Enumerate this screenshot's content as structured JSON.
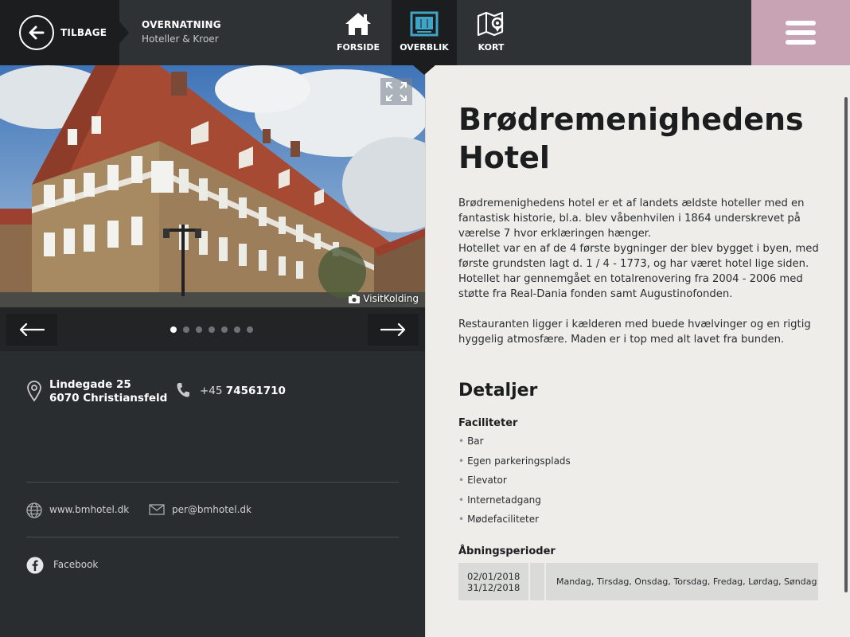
{
  "header": {
    "back_label": "TILBAGE",
    "category_title": "OVERNATNING",
    "category_sub": "Hoteller & Kroer",
    "nav": [
      {
        "label": "FORSIDE",
        "icon": "house-icon"
      },
      {
        "label": "OVERBLIK",
        "icon": "overview-icon",
        "active": true
      },
      {
        "label": "KORT",
        "icon": "map-icon"
      }
    ],
    "menu_icon": "hamburger-menu-icon",
    "menu_color": "#c8a3b3"
  },
  "gallery": {
    "photo_credit": "VisitKolding",
    "slide_count": 7,
    "active_slide": 1
  },
  "contact": {
    "address_line1": "Lindegade 25",
    "address_line2": "6070 Christiansfeld",
    "phone_prefix": "+45",
    "phone_number": "74561710",
    "website": "www.bmhotel.dk",
    "email": "per@bmhotel.dk",
    "facebook": "Facebook"
  },
  "detail": {
    "title_line1": "Brødremenighedens",
    "title_line2": "Hotel",
    "desc_lines": [
      "Brødremenighedens hotel er et af landets ældste hoteller med en",
      "fantastisk historie, bl.a. blev våbenhvilen i 1864 underskrevet på",
      "værelse 7 hvor erklæringen hænger.",
      "Hotellet var en af de 4 første bygninger der blev bygget i byen, med",
      "første grundsten lagt d. 1 / 4 - 1773, og har været hotel lige siden.",
      "Hotellet har gennemgået en totalrenovering fra 2004 - 2006 med",
      "støtte fra Real-Dania fonden samt Augustinofonden."
    ],
    "desc2_lines": [
      "Restauranten ligger i kælderen med buede hvælvinger og en rigtig",
      "hyggelig atmosfære. Maden er i top med alt lavet fra bunden."
    ],
    "details_heading": "Detaljer",
    "facilities_heading": "Faciliteter",
    "facilities": [
      "Bar",
      "Egen parkeringsplads",
      "Elevator",
      "Internetadgang",
      "Mødefaciliteter"
    ],
    "opening_heading": "Åbningsperioder",
    "opening": {
      "from": "02/01/2018",
      "to": "31/12/2018",
      "days": "Mandag, Tirsdag, Onsdag, Torsdag, Fredag, Lørdag, Søndag"
    }
  }
}
